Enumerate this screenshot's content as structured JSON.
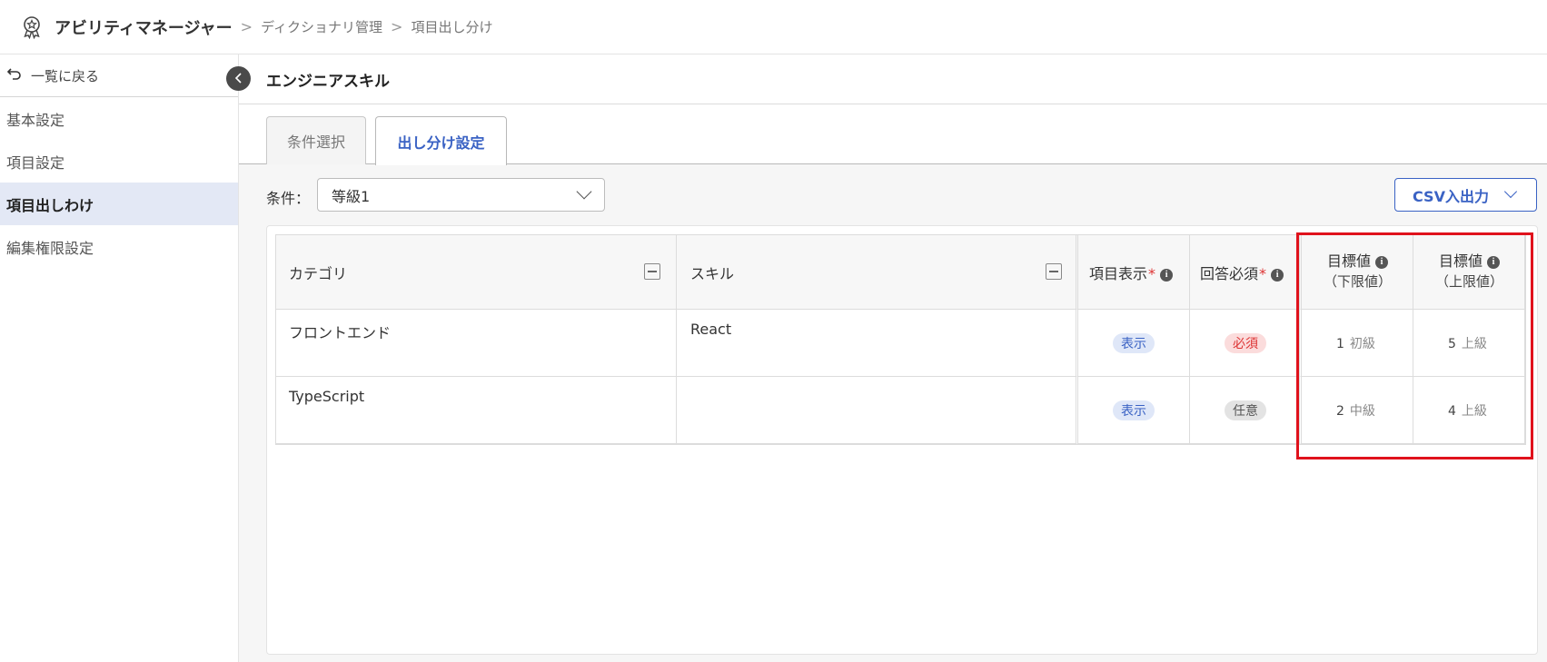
{
  "header": {
    "app_name": "アビリティマネージャー",
    "breadcrumb": [
      "ディクショナリ管理",
      "項目出し分け"
    ],
    "separator": ">"
  },
  "sidebar": {
    "back_label": "一覧に戻る",
    "items": [
      {
        "label": "基本設定",
        "active": false
      },
      {
        "label": "項目設定",
        "active": false
      },
      {
        "label": "項目出しわけ",
        "active": true
      },
      {
        "label": "編集権限設定",
        "active": false
      }
    ]
  },
  "page": {
    "title": "エンジニアスキル",
    "tabs": [
      {
        "label": "条件選択",
        "active": false
      },
      {
        "label": "出し分け設定",
        "active": true
      }
    ],
    "condition_label": "条件：",
    "condition_value": "等級1",
    "csv_button": "CSV入出力"
  },
  "table": {
    "headers": {
      "category": "カテゴリ",
      "skill": "スキル",
      "display": "項目表示",
      "required": "回答必須",
      "target": "目標値",
      "lower": "（下限値）",
      "upper": "（上限値）",
      "asterisk": "*",
      "info": "i"
    },
    "rows": [
      {
        "category": "フロントエンド",
        "skill": "React",
        "display": "表示",
        "required": "必須",
        "lower_num": "1",
        "lower_level": "初級",
        "upper_num": "5",
        "upper_level": "上級"
      },
      {
        "category": "TypeScript",
        "skill": "",
        "display": "表示",
        "required": "任意",
        "lower_num": "2",
        "lower_level": "中級",
        "upper_num": "4",
        "upper_level": "上級"
      }
    ]
  },
  "colors": {
    "accent": "#3a62c4",
    "highlight_box": "#e0121c",
    "sidebar_active": "#e3e8f5"
  }
}
